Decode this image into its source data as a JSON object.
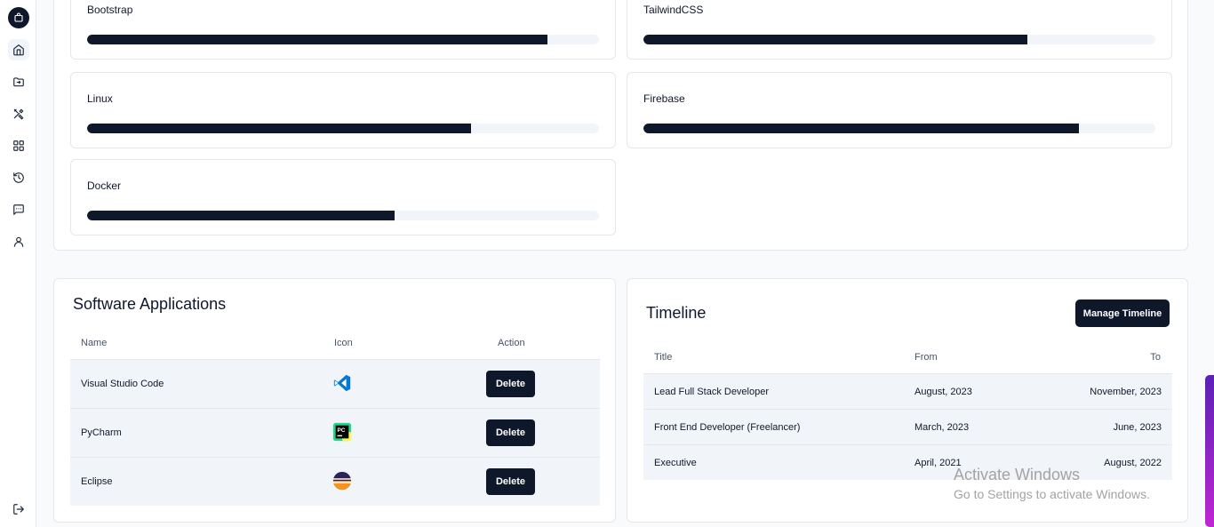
{
  "sidebar": {
    "items": [
      {
        "icon": "home-icon",
        "active": true
      },
      {
        "icon": "folder-icon"
      },
      {
        "icon": "tools-icon"
      },
      {
        "icon": "grid-icon"
      },
      {
        "icon": "history-icon"
      },
      {
        "icon": "message-icon"
      },
      {
        "icon": "user-icon"
      }
    ],
    "logout_icon": "logout-icon"
  },
  "skills": [
    {
      "name": "Bootstrap",
      "level": 90
    },
    {
      "name": "TailwindCSS",
      "level": 75
    },
    {
      "name": "Linux",
      "level": 75
    },
    {
      "name": "Firebase",
      "level": 85
    },
    {
      "name": "Docker",
      "level": 60
    }
  ],
  "software": {
    "title": "Software Applications",
    "headers": {
      "name": "Name",
      "icon": "Icon",
      "action": "Action"
    },
    "rows": [
      {
        "name": "Visual Studio Code",
        "icon": "vscode-icon",
        "action": "Delete"
      },
      {
        "name": "PyCharm",
        "icon": "pycharm-icon",
        "action": "Delete"
      },
      {
        "name": "Eclipse",
        "icon": "eclipse-icon",
        "action": "Delete"
      }
    ]
  },
  "timeline": {
    "title": "Timeline",
    "manage_button": "Manage Timeline",
    "headers": {
      "title": "Title",
      "from": "From",
      "to": "To"
    },
    "rows": [
      {
        "title": "Lead Full Stack Developer",
        "from": "August, 2023",
        "to": "November, 2023"
      },
      {
        "title": "Front End Developer (Freelancer)",
        "from": "March, 2023",
        "to": "June, 2023"
      },
      {
        "title": "Executive",
        "from": "April, 2021",
        "to": "August, 2022"
      }
    ]
  },
  "watermark": {
    "line1": "Activate Windows",
    "line2": "Go to Settings to activate Windows."
  },
  "colors": {
    "primary": "#0f172a",
    "track": "#f1f5f9",
    "row_bg": "#f1f5f9",
    "scrollbar": "#a21caf"
  }
}
